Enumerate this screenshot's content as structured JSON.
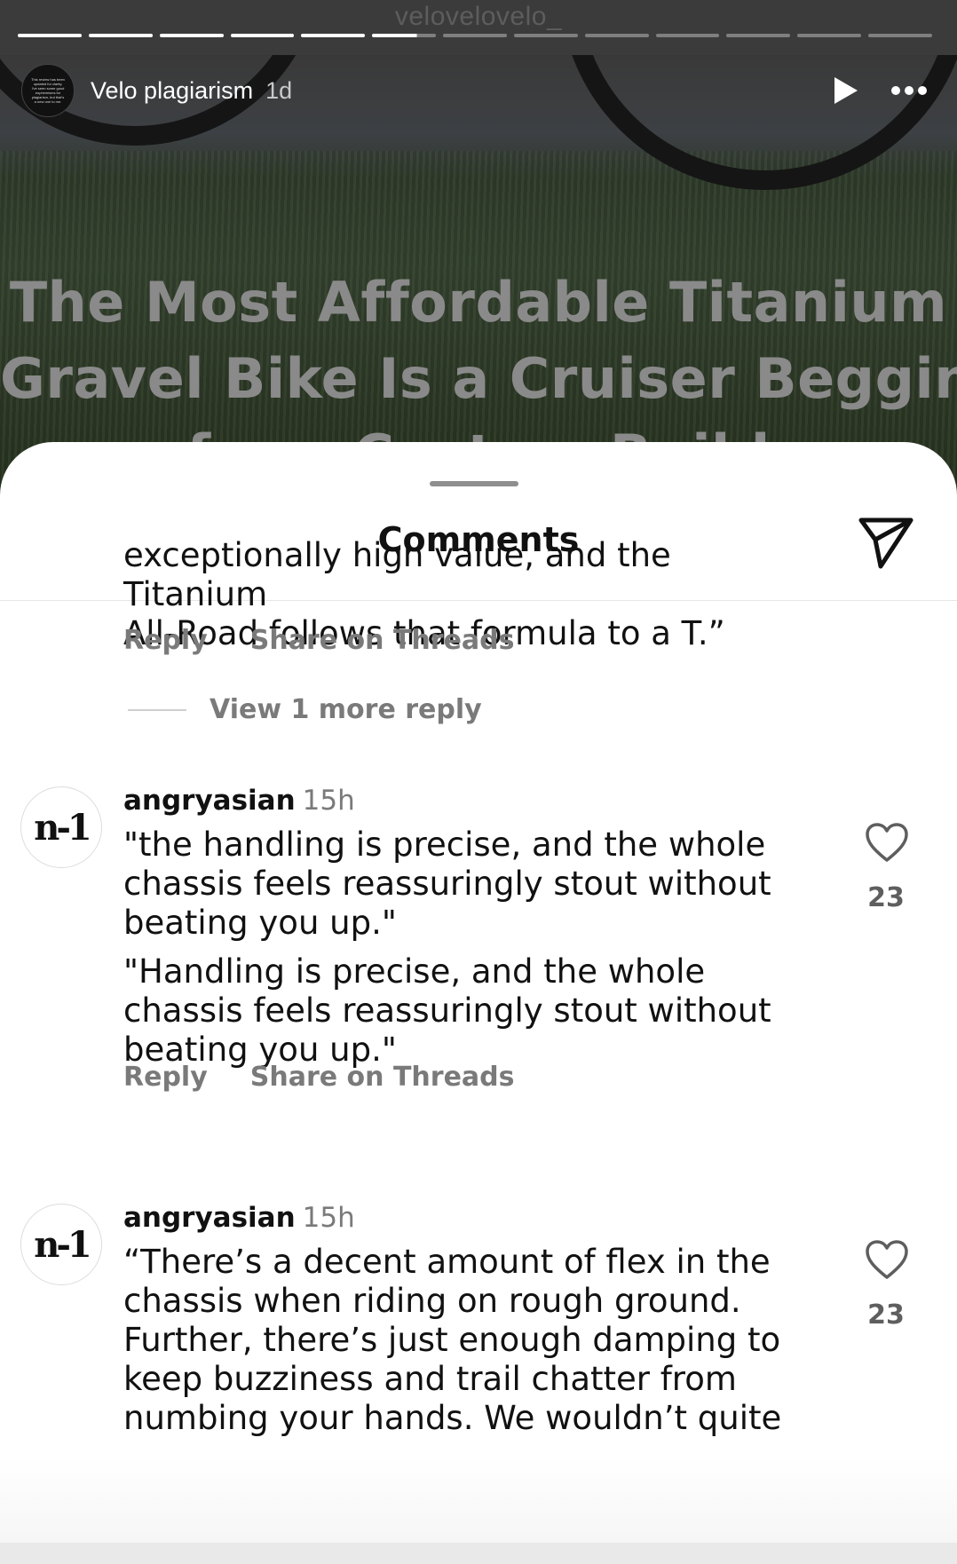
{
  "story": {
    "handle": "velovelovelo_",
    "title": "Velo plagiarism",
    "age": "1d",
    "avatar_lines": [
      "This review has been",
      "updated for clarity.",
      "",
      "I've seen some good",
      "euphemisms for",
      "plagiarism, but that's",
      "a new one to me."
    ],
    "headline_lines": [
      "The Most Affordable Titanium",
      "Gravel Bike Is a Cruiser Begging",
      "for a Custom Build"
    ],
    "progress": {
      "total_segments": 13,
      "completed_segments": 5,
      "current_segment_fraction": 0.7
    }
  },
  "comments_sheet": {
    "title": "Comments",
    "partial_comment": {
      "lines": [
        "exceptionally high value, and the Titanium",
        "All-Road follows that formula to a T.”"
      ],
      "reply_label": "Reply",
      "share_label": "Share on Threads"
    },
    "view_more_replies": "View 1 more reply",
    "comments": [
      {
        "avatar_text": "n-1",
        "username": "angryasian",
        "time": "15h",
        "text_lines": [
          "\"the handling is precise, and the whole",
          "chassis feels reassuringly stout without",
          "beating you up.\""
        ],
        "text_lines_2": [
          "\"Handling is precise, and the whole",
          "chassis feels reassuringly stout without",
          "beating you up.\""
        ],
        "likes": "23",
        "reply_label": "Reply",
        "share_label": "Share on Threads"
      },
      {
        "avatar_text": "n-1",
        "username": "angryasian",
        "time": "15h",
        "text_lines": [
          "“There’s a decent amount of flex in the",
          "chassis when riding on rough ground.",
          "Further, there’s just enough damping to",
          "keep buzziness and trail chatter from",
          "numbing your hands. We wouldn’t quite"
        ],
        "likes": "23"
      }
    ]
  },
  "colors": {
    "sheet_background": "#ffffff",
    "muted_text": "#7a7a7a",
    "primary_text": "#111111",
    "headline_overlay": "#8a8a8a"
  }
}
